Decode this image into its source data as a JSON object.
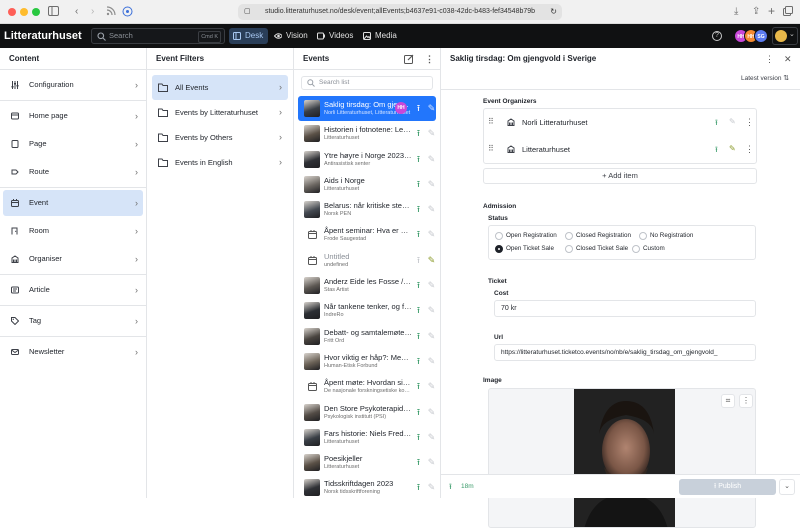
{
  "browser": {
    "url": "studio.litteraturhuset.no/desk/event;allEvents;b4637e91-c038-42dc-b483-fef34548b79b"
  },
  "nav": {
    "brand": "Litteraturhuset",
    "search_placeholder": "Search",
    "search_shortcut": "Cmd K",
    "tabs": [
      {
        "label": "Desk",
        "icon": "desk-icon"
      },
      {
        "label": "Vision",
        "icon": "eye-icon"
      },
      {
        "label": "Videos",
        "icon": "video-icon"
      },
      {
        "label": "Media",
        "icon": "image-icon"
      }
    ],
    "avatars": [
      {
        "initials": "HH",
        "color": "#c947d9"
      },
      {
        "initials": "HH",
        "color": "#f58a30"
      },
      {
        "initials": "SG",
        "color": "#5c7cf0"
      }
    ],
    "accent": "#2276fc"
  },
  "content": {
    "title": "Content",
    "groups": [
      [
        {
          "label": "Configuration",
          "icon": "sliders-icon"
        }
      ],
      [
        {
          "label": "Home page",
          "icon": "home-page-icon"
        },
        {
          "label": "Page",
          "icon": "page-icon"
        },
        {
          "label": "Route",
          "icon": "route-icon"
        }
      ],
      [
        {
          "label": "Event",
          "icon": "calendar-icon",
          "selected": true
        },
        {
          "label": "Room",
          "icon": "room-icon"
        },
        {
          "label": "Organiser",
          "icon": "building-icon"
        }
      ],
      [
        {
          "label": "Article",
          "icon": "article-icon"
        }
      ],
      [
        {
          "label": "Tag",
          "icon": "tag-icon"
        }
      ],
      [
        {
          "label": "Newsletter",
          "icon": "mail-icon"
        }
      ]
    ]
  },
  "filters": {
    "title": "Event Filters",
    "items": [
      {
        "label": "All Events",
        "selected": true
      },
      {
        "label": "Events by Litteraturhuset"
      },
      {
        "label": "Events by Others"
      },
      {
        "label": "Events in English"
      }
    ]
  },
  "events": {
    "title": "Events",
    "search_placeholder": "Search list",
    "selected_badge": "HH",
    "items": [
      {
        "title": "Saklig tirsdag: Om gjengvold i Sverige",
        "sub": "Norli Litteraturhuset, Litteraturhuset",
        "thumb": "photo",
        "status": "published",
        "selected": true
      },
      {
        "title": "Historien i fotnotene: Leif Sverre Rosén",
        "sub": "Litteraturhuset",
        "thumb": "photo",
        "status": "published"
      },
      {
        "title": "Ytre høyre i Norge 2023: Trusselbilde",
        "sub": "Antirasistisk senter",
        "thumb": "photo",
        "status": "published"
      },
      {
        "title": "Aids i Norge",
        "sub": "Litteraturhuset",
        "thumb": "photo",
        "status": "published"
      },
      {
        "title": "Belarus: når kritiske stemmer tier",
        "sub": "Norsk PEN",
        "thumb": "photo",
        "status": "published"
      },
      {
        "title": "Åpent seminar: Hva er en by?",
        "sub": "Frode Saugestad",
        "thumb": "calendar",
        "status": "published"
      },
      {
        "title": "Untitled",
        "sub": "undefined",
        "thumb": "calendar",
        "status": "draft"
      },
      {
        "title": "Anderz Eide les Fosse / Sessions",
        "sub": "Stas Artist",
        "thumb": "photo",
        "status": "published"
      },
      {
        "title": "Når tankene tenker, og føler",
        "sub": "IndreRo",
        "thumb": "photo",
        "status": "published"
      },
      {
        "title": "Debatt- og samtalemøte om Palestina",
        "sub": "Fritt Ord",
        "thumb": "photo",
        "status": "published"
      },
      {
        "title": "Hvor viktig er håp?: Med Hilde Hammer",
        "sub": "Human-Etisk Forbund",
        "thumb": "photo",
        "status": "published"
      },
      {
        "title": "Åpent møte: Hvordan sikre forskningsetikken",
        "sub": "De nasjonale forskningsetiske komiteene",
        "thumb": "calendar",
        "status": "published"
      },
      {
        "title": "Den Store Psykoterapidebatten",
        "sub": "Psykologisk institutt (PSI)",
        "thumb": "photo",
        "status": "published"
      },
      {
        "title": "Fars historie: Niels Fredrik Dahl",
        "sub": "Litteraturhuset",
        "thumb": "photo",
        "status": "published"
      },
      {
        "title": "Poesikjeller",
        "sub": "Litteraturhuset",
        "thumb": "photo",
        "status": "published"
      },
      {
        "title": "Tidsskriftdagen 2023",
        "sub": "Norsk tidsskriftforening",
        "thumb": "photo",
        "status": "published"
      }
    ]
  },
  "doc": {
    "title": "Saklig tirsdag: Om gjengvold i Sverige",
    "version": "Latest version",
    "organizers_label": "Event Organizers",
    "organizers": [
      {
        "name": "Norli Litteraturhuset"
      },
      {
        "name": "Litteraturhuset"
      }
    ],
    "add_item": "Add item",
    "admission_label": "Admission",
    "status_label": "Status",
    "status_options": [
      "Open Registration",
      "Closed Registration",
      "No Registration",
      "Open Ticket Sale",
      "Closed Ticket Sale",
      "Custom"
    ],
    "status_selected": "Open Ticket Sale",
    "ticket_label": "Ticket",
    "cost_label": "Cost",
    "cost_value": "70 kr",
    "url_label": "Url",
    "url_value": "https://litteraturhuset.ticketco.events/no/nb/e/saklig_tirsdag_om_gjengvold_",
    "image_label": "Image",
    "footer_time": "18m",
    "publish_label": "Publish"
  }
}
